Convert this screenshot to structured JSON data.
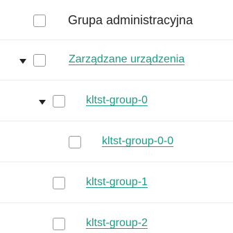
{
  "header": {
    "column_title": "Grupa administracyjna"
  },
  "tree": {
    "root": {
      "label": "Zarządzane urządzenia"
    },
    "group0": {
      "label": "kltst-group-0"
    },
    "group00": {
      "label": "kltst-group-0-0"
    },
    "group1": {
      "label": "kltst-group-1"
    },
    "group2": {
      "label": "kltst-group-2"
    }
  },
  "colors": {
    "link": "#1a9c86",
    "text": "#262626",
    "checkbox_border": "#9a9a9a"
  }
}
